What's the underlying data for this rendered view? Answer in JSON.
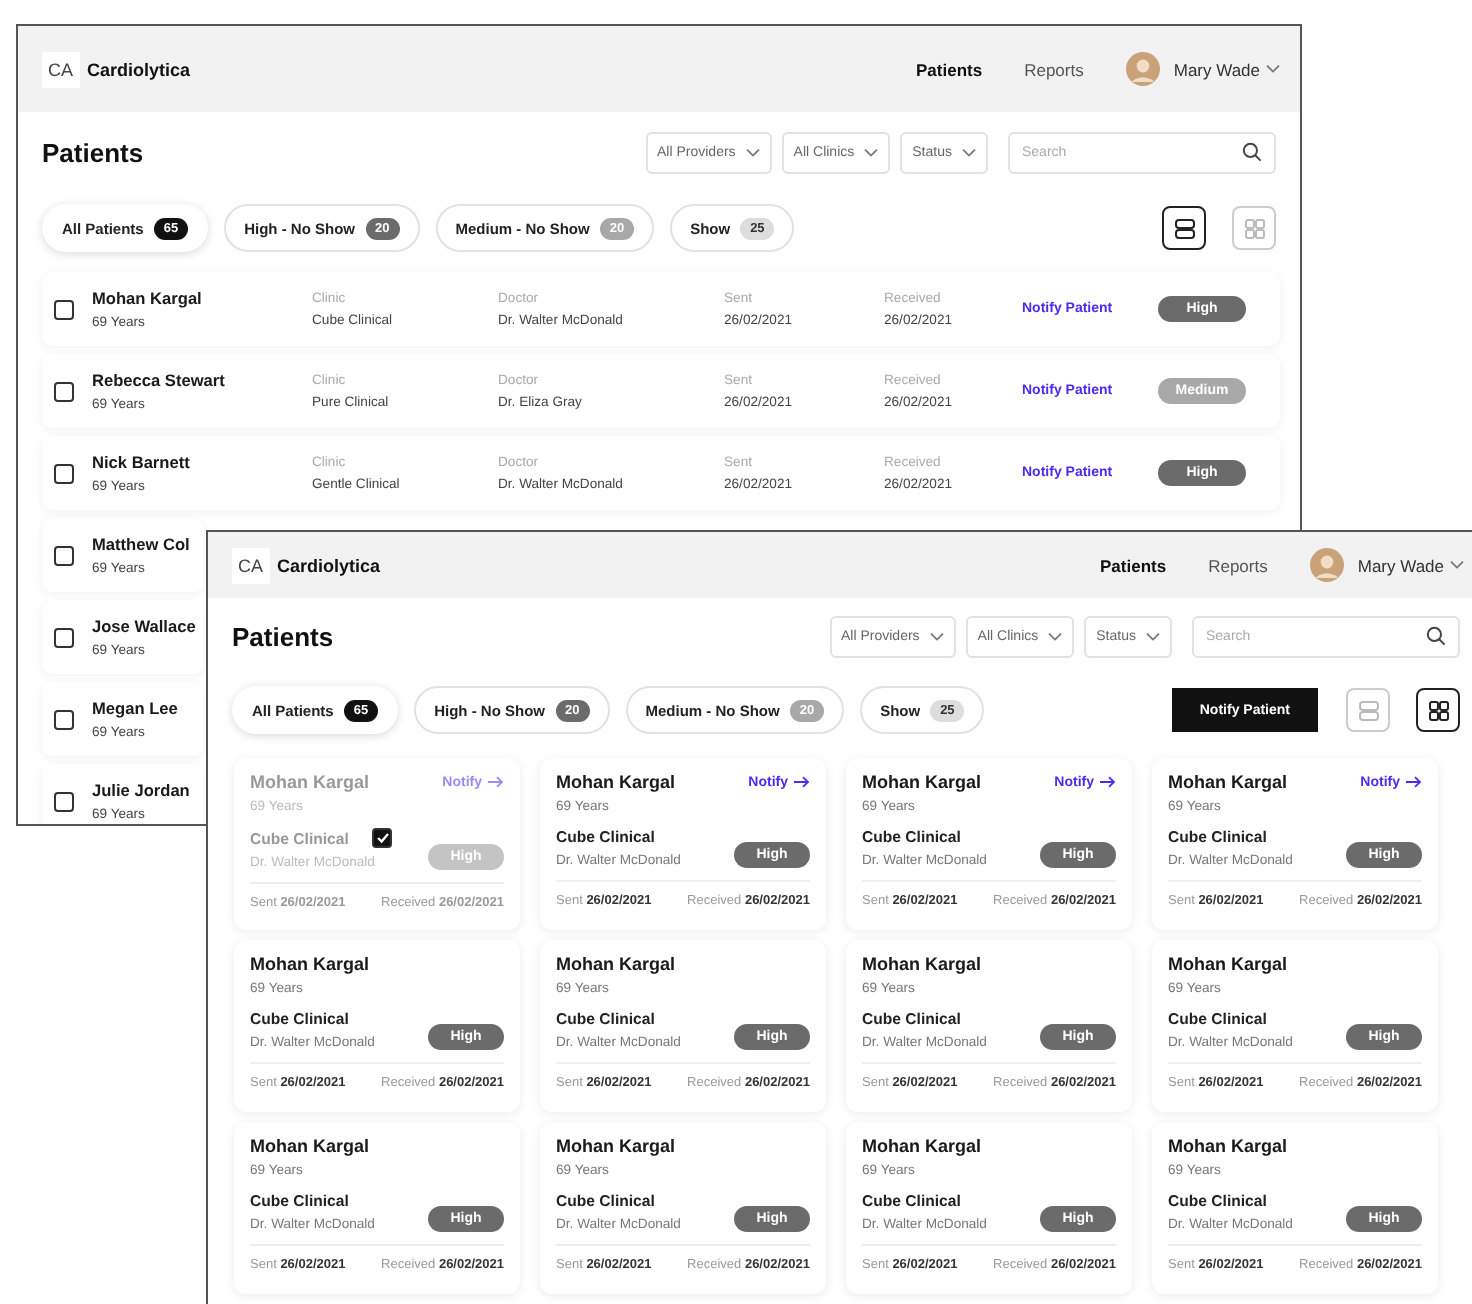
{
  "back_window": {
    "header": {
      "logo_mark": "CA",
      "brand": "Cardiolytica",
      "nav": [
        {
          "label": "Patients",
          "selected": true
        },
        {
          "label": "Reports",
          "selected": false
        }
      ],
      "user": "Mary Wade"
    },
    "title": "Patients",
    "filters": [
      "All Providers",
      "All Clinics",
      "Status"
    ],
    "search": {
      "placeholder": "Search"
    },
    "tabs": [
      {
        "label": "All Patients",
        "count": "65",
        "color": "#111111",
        "selected": true
      },
      {
        "label": "High - No Show",
        "count": "20",
        "color": "#6b6b6b",
        "selected": false
      },
      {
        "label": "Medium - No Show",
        "count": "20",
        "color": "#a8a8a8",
        "selected": false
      },
      {
        "label": "Show",
        "count": "25",
        "color": "#dddddd",
        "selected": false
      }
    ],
    "views": [
      {
        "kind": "list",
        "selected": true
      },
      {
        "kind": "grid",
        "selected": false
      }
    ],
    "rows": [
      {
        "kind": "full",
        "checked": false,
        "name": "Mohan Kargal",
        "age": "69 Years",
        "clinic_label": "Clinic",
        "clinic": "Cube Clinical",
        "doctor_label": "Doctor",
        "doctor": "Dr. Walter McDonald",
        "sent_label": "Sent",
        "sent": "26/02/2021",
        "received_label": "Received",
        "received": "26/02/2021",
        "action": "Notify Patient",
        "risk": "High",
        "color": "#6b6b6b"
      },
      {
        "kind": "full",
        "checked": false,
        "name": "Rebecca Stewart",
        "age": "69 Years",
        "clinic_label": "Clinic",
        "clinic": "Pure Clinical",
        "doctor_label": "Doctor",
        "doctor": "Dr. Eliza Gray",
        "sent_label": "Sent",
        "sent": "26/02/2021",
        "received_label": "Received",
        "received": "26/02/2021",
        "action": "Notify Patient",
        "risk": "Medium",
        "color": "#a8a8a8"
      },
      {
        "kind": "full",
        "checked": false,
        "name": "Nick Barnett",
        "age": "69 Years",
        "clinic_label": "Clinic",
        "clinic": "Gentle Clinical",
        "doctor_label": "Doctor",
        "doctor": "Dr. Walter McDonald",
        "sent_label": "Sent",
        "sent": "26/02/2021",
        "received_label": "Received",
        "received": "26/02/2021",
        "action": "Notify Patient",
        "risk": "High",
        "color": "#6b6b6b"
      },
      {
        "kind": "covered",
        "checked": false,
        "name": "Matthew Col",
        "age": "69 Years"
      },
      {
        "kind": "covered",
        "checked": false,
        "name": "Jose Wallace",
        "age": "69 Years"
      },
      {
        "kind": "covered",
        "checked": false,
        "name": "Megan Lee",
        "age": "69 Years"
      },
      {
        "kind": "covered",
        "checked": false,
        "name": "Julie Jordan",
        "age": "69 Years"
      }
    ]
  },
  "front_window": {
    "header": {
      "logo_mark": "CA",
      "brand": "Cardiolytica",
      "nav": [
        {
          "label": "Patients",
          "selected": true
        },
        {
          "label": "Reports",
          "selected": false
        }
      ],
      "user": "Mary Wade"
    },
    "title": "Patients",
    "filters": [
      "All Providers",
      "All Clinics",
      "Status"
    ],
    "search": {
      "placeholder": "Search"
    },
    "tabs": [
      {
        "label": "All Patients",
        "count": "65",
        "color": "#111111",
        "selected": true
      },
      {
        "label": "High - No Show",
        "count": "20",
        "color": "#6b6b6b",
        "selected": false
      },
      {
        "label": "Medium - No Show",
        "count": "20",
        "color": "#a8a8a8",
        "selected": false
      },
      {
        "label": "Show",
        "count": "25",
        "color": "#dddddd",
        "selected": false
      }
    ],
    "action": "Notify Patient",
    "views": [
      {
        "kind": "list",
        "selected": false
      },
      {
        "kind": "grid",
        "selected": true
      }
    ],
    "cards": [
      {
        "selected": true,
        "name": "Mohan Kargal",
        "age": "69 Years",
        "notify": "Notify",
        "clinic": "Cube Clinical",
        "doctor": "Dr. Walter McDonald",
        "risk": "High",
        "color": "#c4c4c4",
        "sent_label": "Sent",
        "sent": "26/02/2021",
        "received_label": "Received",
        "received": "26/02/2021"
      },
      {
        "selected": false,
        "name": "Mohan Kargal",
        "age": "69 Years",
        "notify": "Notify",
        "clinic": "Cube Clinical",
        "doctor": "Dr. Walter McDonald",
        "risk": "High",
        "color": "#6b6b6b",
        "sent_label": "Sent",
        "sent": "26/02/2021",
        "received_label": "Received",
        "received": "26/02/2021"
      },
      {
        "selected": false,
        "name": "Mohan Kargal",
        "age": "69 Years",
        "notify": "Notify",
        "clinic": "Cube Clinical",
        "doctor": "Dr. Walter McDonald",
        "risk": "High",
        "color": "#6b6b6b",
        "sent_label": "Sent",
        "sent": "26/02/2021",
        "received_label": "Received",
        "received": "26/02/2021"
      },
      {
        "selected": false,
        "name": "Mohan Kargal",
        "age": "69 Years",
        "notify": "Notify",
        "clinic": "Cube Clinical",
        "doctor": "Dr. Walter McDonald",
        "risk": "High",
        "color": "#6b6b6b",
        "sent_label": "Sent",
        "sent": "26/02/2021",
        "received_label": "Received",
        "received": "26/02/2021"
      },
      {
        "selected": false,
        "name": "Mohan Kargal",
        "age": "69 Years",
        "clinic": "Cube Clinical",
        "doctor": "Dr. Walter McDonald",
        "risk": "High",
        "color": "#6b6b6b",
        "sent_label": "Sent",
        "sent": "26/02/2021",
        "received_label": "Received",
        "received": "26/02/2021"
      },
      {
        "selected": false,
        "name": "Mohan Kargal",
        "age": "69 Years",
        "clinic": "Cube Clinical",
        "doctor": "Dr. Walter McDonald",
        "risk": "High",
        "color": "#6b6b6b",
        "sent_label": "Sent",
        "sent": "26/02/2021",
        "received_label": "Received",
        "received": "26/02/2021"
      },
      {
        "selected": false,
        "name": "Mohan Kargal",
        "age": "69 Years",
        "clinic": "Cube Clinical",
        "doctor": "Dr. Walter McDonald",
        "risk": "High",
        "color": "#6b6b6b",
        "sent_label": "Sent",
        "sent": "26/02/2021",
        "received_label": "Received",
        "received": "26/02/2021"
      },
      {
        "selected": false,
        "name": "Mohan Kargal",
        "age": "69 Years",
        "clinic": "Cube Clinical",
        "doctor": "Dr. Walter McDonald",
        "risk": "High",
        "color": "#6b6b6b",
        "sent_label": "Sent",
        "sent": "26/02/2021",
        "received_label": "Received",
        "received": "26/02/2021"
      },
      {
        "selected": false,
        "name": "Mohan Kargal",
        "age": "69 Years",
        "clinic": "Cube Clinical",
        "doctor": "Dr. Walter McDonald",
        "risk": "High",
        "color": "#6b6b6b",
        "sent_label": "Sent",
        "sent": "26/02/2021",
        "received_label": "Received",
        "received": "26/02/2021"
      },
      {
        "selected": false,
        "name": "Mohan Kargal",
        "age": "69 Years",
        "clinic": "Cube Clinical",
        "doctor": "Dr. Walter McDonald",
        "risk": "High",
        "color": "#6b6b6b",
        "sent_label": "Sent",
        "sent": "26/02/2021",
        "received_label": "Received",
        "received": "26/02/2021"
      },
      {
        "selected": false,
        "name": "Mohan Kargal",
        "age": "69 Years",
        "clinic": "Cube Clinical",
        "doctor": "Dr. Walter McDonald",
        "risk": "High",
        "color": "#6b6b6b",
        "sent_label": "Sent",
        "sent": "26/02/2021",
        "received_label": "Received",
        "received": "26/02/2021"
      },
      {
        "selected": false,
        "name": "Mohan Kargal",
        "age": "69 Years",
        "clinic": "Cube Clinical",
        "doctor": "Dr. Walter McDonald",
        "risk": "High",
        "color": "#6b6b6b",
        "sent_label": "Sent",
        "sent": "26/02/2021",
        "received_label": "Received",
        "received": "26/02/2021"
      }
    ]
  }
}
